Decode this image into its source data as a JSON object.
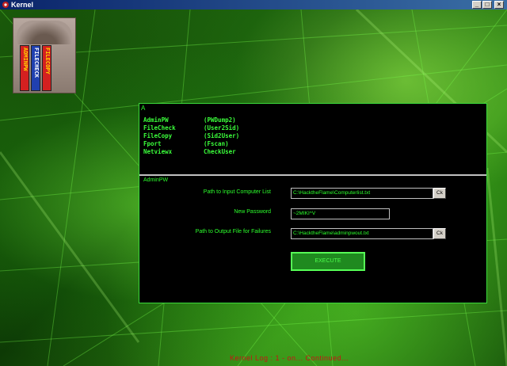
{
  "window": {
    "title": "Kernel",
    "controls": [
      "minimize",
      "maximize",
      "close"
    ]
  },
  "logo": {
    "books": [
      "ADMINPW",
      "FILECHECK",
      "FILECOPY"
    ],
    "book_colors": [
      "#d42020",
      "#2040b0",
      "#d42020"
    ]
  },
  "panel": {
    "top_char": "A",
    "tools_left": [
      "AdminPW",
      "FileCheck",
      "FileCopy",
      "Fport",
      "Netviewx"
    ],
    "tools_right": [
      "(PWDump2)",
      "(User2Sid)",
      "(Sid2User)",
      "(Fscan)",
      "CheckUser"
    ],
    "section_label": "AdminPW",
    "form": {
      "computer_list_label": "Path to Input Computer List",
      "computer_list_value": "C:\\HacktheFlame\\Computerlist.txt",
      "new_password_label": "New Password",
      "new_password_value": "~2MIKI^V",
      "output_file_label": "Path to Output File for Failures",
      "output_file_value": "C:\\HacktheFlame\\adminpwout.txt",
      "browse_label": "Ck",
      "execute_label": "EXECUTE"
    }
  },
  "status_text": "Kernel Log : 1 - on... Continued...",
  "colors": {
    "accent": "#2cff2c",
    "panel_bg": "#000000",
    "status": "#c81414"
  }
}
